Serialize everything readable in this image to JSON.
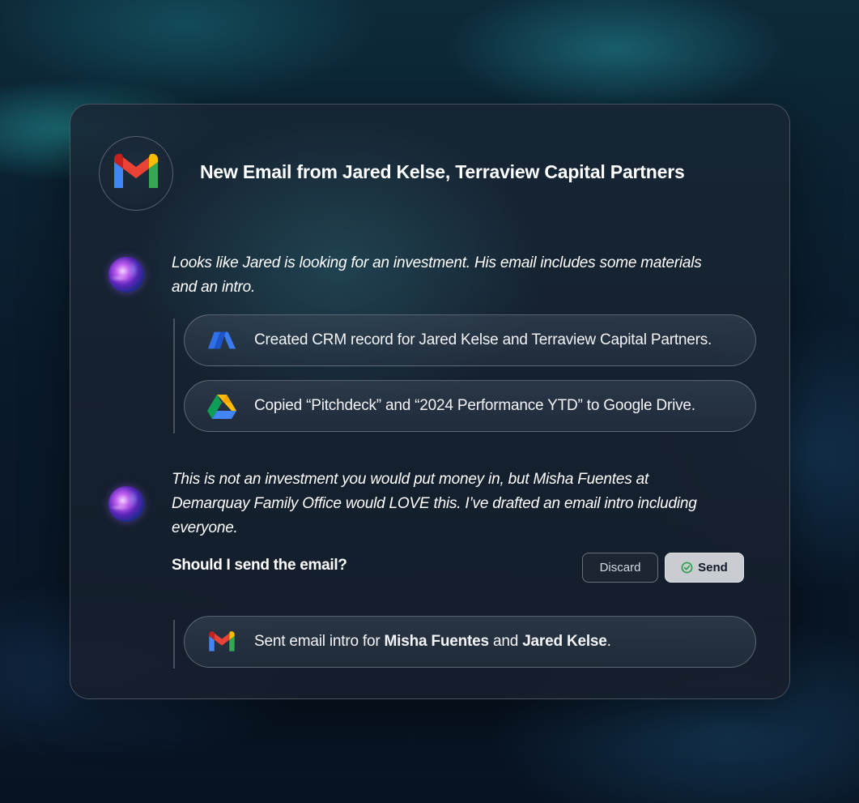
{
  "card": {
    "title": "New Email from Jared Kelse, Terraview Capital Partners",
    "header_icon": "gmail-icon"
  },
  "messages": [
    {
      "avatar": "ai-orb-avatar",
      "lines": [
        "Looks like Jared is looking for an investment. His email includes some materials",
        "and an intro."
      ]
    },
    {
      "avatar": "ai-orb-avatar",
      "lines": [
        "This is not an investment you would put money in, but Misha Fuentes at",
        "Demarquay Family Office would LOVE this. I’ve drafted an email intro including",
        "everyone."
      ]
    }
  ],
  "actions": [
    {
      "icon": "crm-logo-icon",
      "text": "Created CRM record for Jared Kelse and Terraview Capital Partners."
    },
    {
      "icon": "google-drive-icon",
      "text": "Copied “Pitchdeck” and “2024 Performance YTD”  to Google Drive."
    }
  ],
  "prompt": {
    "question": "Should I send the email?",
    "discard_label": "Discard",
    "send_label": "Send"
  },
  "sent": {
    "icon": "gmail-icon",
    "prefix": "Sent email intro for ",
    "person1": "Misha Fuentes",
    "conjunction": " and ",
    "person2": "Jared Kelse",
    "suffix": "."
  },
  "colors": {
    "background": "#0a1a2b",
    "card": "#18263a",
    "send_button": "#c9cdd1",
    "send_check": "#2e9e4f"
  }
}
